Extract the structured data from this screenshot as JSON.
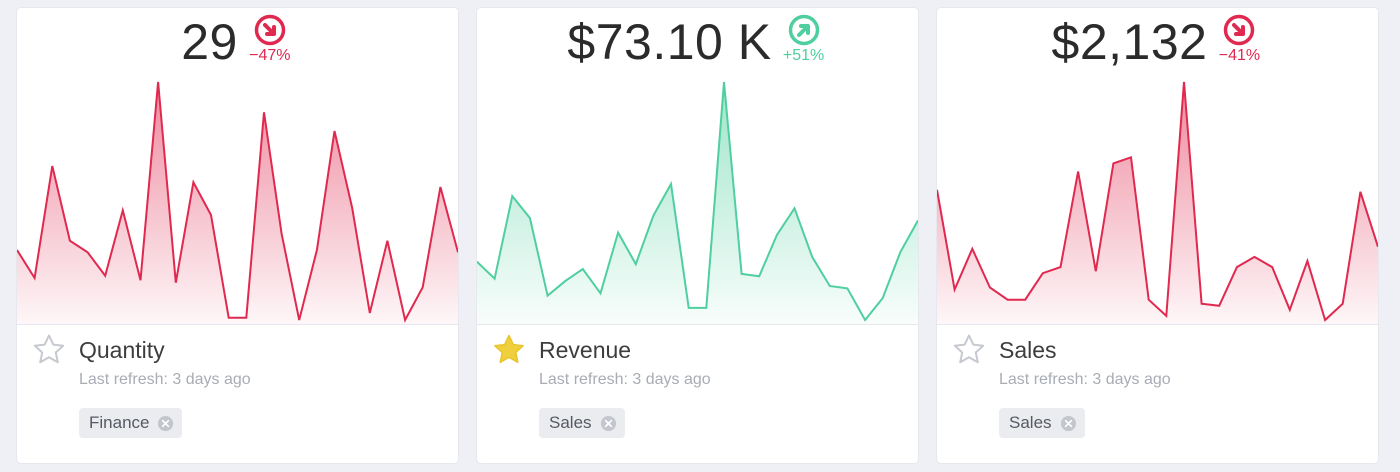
{
  "colors": {
    "negative": "#e0294f",
    "positive": "#4fcf9f",
    "star_active": "#f0cf3c",
    "star_inactive": "#c6c9cf"
  },
  "cards": [
    {
      "value": "29",
      "delta": "−47%",
      "trend": "down",
      "delta_icon": "arrow-down-right-icon",
      "title": "Quantity",
      "refresh": "Last refresh: 3 days ago",
      "tag": "Finance",
      "favorite": false,
      "chart_data": {
        "type": "area",
        "values": [
          30,
          18,
          66,
          34,
          29,
          19,
          47,
          17,
          102,
          16,
          59,
          45,
          1,
          1,
          89,
          37,
          0,
          30,
          81,
          48,
          3,
          34,
          0,
          14,
          57,
          29
        ]
      }
    },
    {
      "value": "$73.10 K",
      "delta": "+51%",
      "trend": "up",
      "delta_icon": "arrow-up-right-icon",
      "title": "Revenue",
      "refresh": "Last refresh: 3 days ago",
      "tag": "Sales",
      "favorite": true,
      "chart_data": {
        "type": "area",
        "values": [
          28,
          21,
          55,
          46,
          14,
          20,
          25,
          15,
          40,
          27,
          47,
          60,
          9,
          9,
          102,
          23,
          22,
          39,
          50,
          30,
          18,
          17,
          4,
          13,
          32,
          45
        ]
      }
    },
    {
      "value": "$2,132",
      "delta": "−41%",
      "trend": "down",
      "delta_icon": "arrow-down-right-icon",
      "title": "Sales",
      "refresh": "Last refresh: 3 days ago",
      "tag": "Sales",
      "favorite": false,
      "chart_data": {
        "type": "area",
        "values": [
          64,
          15,
          35,
          16,
          10,
          10,
          23,
          26,
          73,
          24,
          77,
          80,
          10,
          2,
          117,
          8,
          7,
          26,
          31,
          26,
          5,
          29,
          0,
          8,
          63,
          36
        ]
      }
    }
  ]
}
